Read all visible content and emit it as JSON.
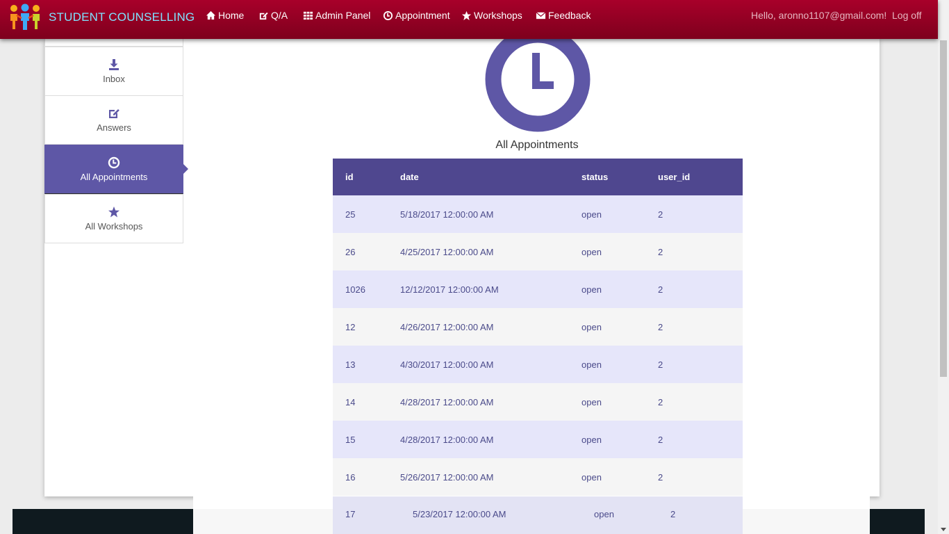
{
  "brand": {
    "name": "STUDENT COUNSELLING",
    "logo": "people-group-logo"
  },
  "nav": {
    "items": [
      {
        "label": "Home",
        "icon": "home-icon"
      },
      {
        "label": "Q/A",
        "icon": "edit-icon"
      },
      {
        "label": "Admin Panel",
        "icon": "grid-icon"
      },
      {
        "label": "Appointment",
        "icon": "clock-icon"
      },
      {
        "label": "Workshops",
        "icon": "star-icon"
      },
      {
        "label": "Feedback",
        "icon": "envelope-icon"
      }
    ],
    "greeting": "Hello, aronno1107@gmail.com!",
    "logoff": "Log off"
  },
  "sidebar": {
    "items": [
      {
        "label": "Inbox",
        "icon": "download-icon"
      },
      {
        "label": "Answers",
        "icon": "edit-icon"
      },
      {
        "label": "All Appointments",
        "icon": "clock-icon",
        "active": true
      },
      {
        "label": "All Workshops",
        "icon": "star-icon"
      }
    ]
  },
  "main": {
    "title": "All Appointments",
    "icon": "clock-icon",
    "table": {
      "headers": [
        "id",
        "date",
        "status",
        "user_id"
      ],
      "rows": [
        [
          "25",
          "5/18/2017 12:00:00 AM",
          "open",
          "2"
        ],
        [
          "26",
          "4/25/2017 12:00:00 AM",
          "open",
          "2"
        ],
        [
          "1026",
          "12/12/2017 12:00:00 AM",
          "open",
          "2"
        ],
        [
          "12",
          "4/26/2017 12:00:00 AM",
          "open",
          "2"
        ],
        [
          "13",
          "4/30/2017 12:00:00 AM",
          "open",
          "2"
        ],
        [
          "14",
          "4/28/2017 12:00:00 AM",
          "open",
          "2"
        ],
        [
          "15",
          "4/28/2017 12:00:00 AM",
          "open",
          "2"
        ],
        [
          "16",
          "5/26/2017 12:00:00 AM",
          "open",
          "2"
        ]
      ],
      "partial_row": [
        "17",
        "5/23/2017 12:00:00 AM",
        "open",
        "2"
      ]
    }
  },
  "colors": {
    "navbar": "#9a0026",
    "brand_text": "#7fe3ff",
    "accent": "#5e57a6",
    "table_header": "#4f478f",
    "row_odd": "#e6e6fa",
    "row_even": "#f5f5f5",
    "footer": "#0f1a1f"
  }
}
